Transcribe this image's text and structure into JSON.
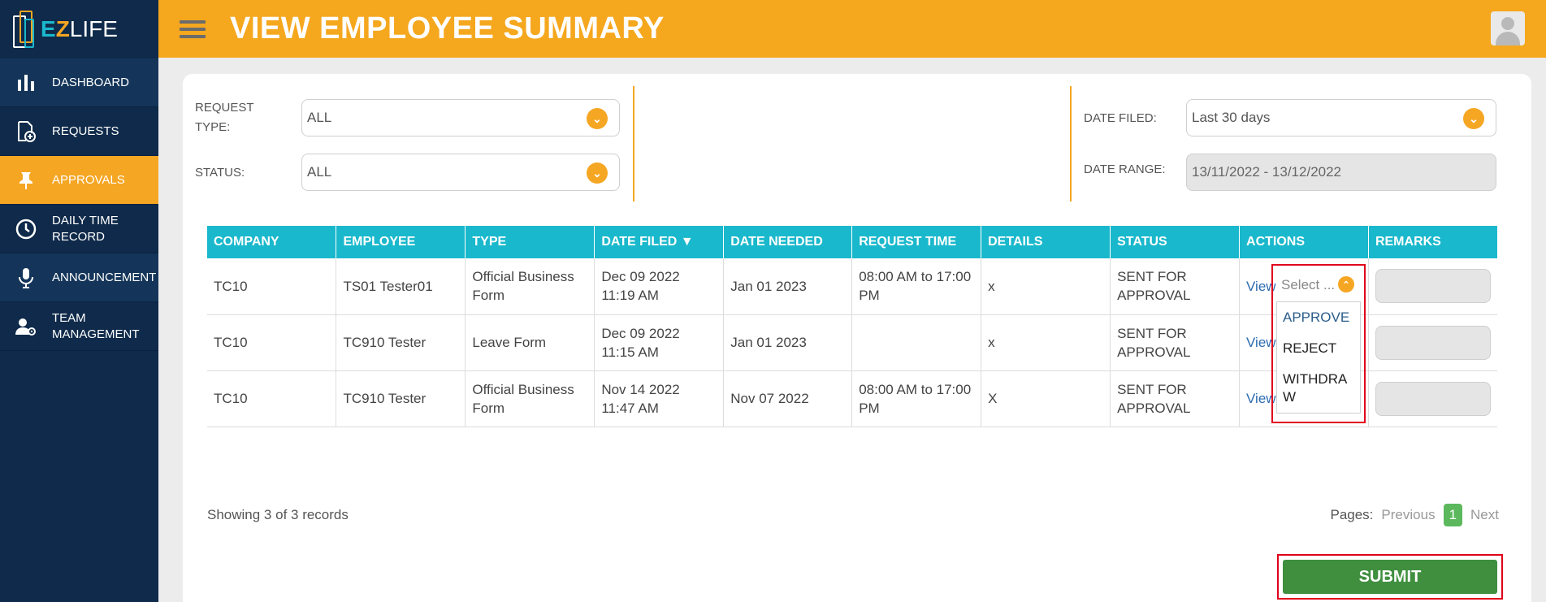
{
  "app": {
    "logo_e": "E",
    "logo_z": "Z",
    "logo_life": "LIFE"
  },
  "header": {
    "title": "VIEW EMPLOYEE SUMMARY"
  },
  "sidebar": {
    "items": [
      {
        "label": "DASHBOARD",
        "icon": "bar-chart-icon"
      },
      {
        "label": "REQUESTS",
        "icon": "document-add-icon"
      },
      {
        "label": "APPROVALS",
        "icon": "pin-icon",
        "active": true
      },
      {
        "label": "DAILY TIME\nRECORD",
        "icon": "clock-icon"
      },
      {
        "label": "ANNOUNCEMENT",
        "icon": "microphone-icon"
      },
      {
        "label": "TEAM\nMANAGEMENT",
        "icon": "user-settings-icon"
      }
    ]
  },
  "filters": {
    "request_type_label": "REQUEST TYPE:",
    "request_type_value": "ALL",
    "status_label": "STATUS:",
    "status_value": "ALL",
    "date_filed_label": "DATE FILED:",
    "date_filed_value": "Last 30 days",
    "date_range_label": "DATE RANGE:",
    "date_range_value": "13/11/2022 - 13/12/2022"
  },
  "table": {
    "headers": [
      "COMPANY",
      "EMPLOYEE",
      "TYPE",
      "DATE FILED ▼",
      "DATE NEEDED",
      "REQUEST TIME",
      "DETAILS",
      "STATUS",
      "ACTIONS",
      "REMARKS"
    ],
    "rows": [
      {
        "company": "TC10",
        "employee": "TS01 Tester01",
        "type": "Official Business Form",
        "date_filed": "Dec 09 2022 11:19 AM",
        "date_needed": "Jan 01 2023",
        "request_time": "08:00 AM to 17:00 PM",
        "details": "x",
        "status": "SENT FOR APPROVAL",
        "action": "View"
      },
      {
        "company": "TC10",
        "employee": "TC910 Tester",
        "type": "Leave Form",
        "date_filed": "Dec 09 2022 11:15 AM",
        "date_needed": "Jan 01 2023",
        "request_time": "",
        "details": "x",
        "status": "SENT FOR APPROVAL",
        "action": "View"
      },
      {
        "company": "TC10",
        "employee": "TC910 Tester",
        "type": "Official Business Form",
        "date_filed": "Nov 14 2022 11:47 AM",
        "date_needed": "Nov 07 2022",
        "request_time": "08:00 AM to 17:00 PM",
        "details": "X",
        "status": "SENT FOR APPROVAL",
        "action": "View"
      }
    ]
  },
  "action_dropdown": {
    "placeholder": "Select ...",
    "options": [
      "APPROVE",
      "REJECT",
      "WITHDRAW"
    ]
  },
  "footer": {
    "showing": "Showing 3 of 3 records",
    "pages_label": "Pages:",
    "previous": "Previous",
    "current_page": "1",
    "next": "Next"
  },
  "submit_label": "SUBMIT",
  "colors": {
    "accent": "#f5a623",
    "sidebar": "#0f2a4a",
    "table_header": "#1ab8cc",
    "submit": "#3f8f3f"
  }
}
